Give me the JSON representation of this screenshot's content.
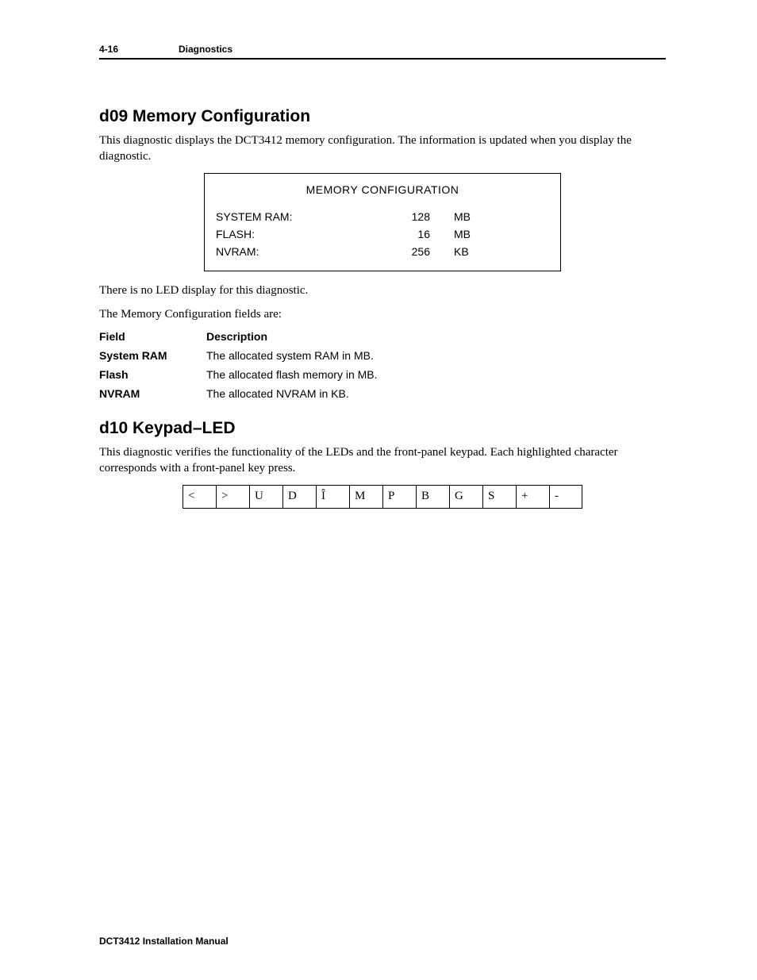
{
  "header": {
    "page_num": "4-16",
    "section": "Diagnostics"
  },
  "d09": {
    "heading": "d09 Memory Configuration",
    "intro": "This diagnostic displays the DCT3412 memory configuration. The information is updated when you display the diagnostic.",
    "box": {
      "title": "MEMORY CONFIGURATION",
      "rows": [
        {
          "label": "SYSTEM RAM:",
          "value": "128",
          "unit": "MB"
        },
        {
          "label": "FLASH:",
          "value": "16",
          "unit": "MB"
        },
        {
          "label": "NVRAM:",
          "value": "256",
          "unit": "KB"
        }
      ]
    },
    "note": "There is no LED display for this diagnostic.",
    "fields_intro": "The Memory Configuration fields are:",
    "fields_header": {
      "c1": "Field",
      "c2": "Description"
    },
    "fields": [
      {
        "c1": "System RAM",
        "c2": "The allocated system RAM in MB."
      },
      {
        "c1": "Flash",
        "c2": "The allocated flash memory in MB."
      },
      {
        "c1": "NVRAM",
        "c2": "The allocated NVRAM in KB."
      }
    ]
  },
  "d10": {
    "heading": "d10 Keypad–LED",
    "intro": "This diagnostic verifies the functionality of the LEDs and the front-panel keypad. Each highlighted character corresponds with a front-panel key press.",
    "keys": [
      "<",
      ">",
      "U",
      "D",
      "Î",
      "M",
      "P",
      "B",
      "G",
      "S",
      "+",
      "-"
    ]
  },
  "footer": "DCT3412 Installation Manual"
}
